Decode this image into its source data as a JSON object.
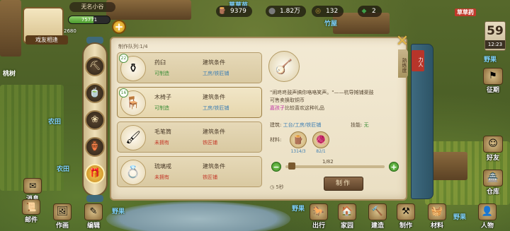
{
  "hud": {
    "title": "无名小谷",
    "exp_value": "75771",
    "exp_fraction": 0.6,
    "small_stat": "2680",
    "avatar_name": "戏友相逢",
    "plus": "+",
    "resources": [
      {
        "icon": "wood-icon",
        "glyph": "🪵",
        "value": "9379",
        "color": "#8a5a2a"
      },
      {
        "icon": "stone-icon",
        "glyph": "⬤",
        "value": "1.82万",
        "color": "#7a7a7a"
      },
      {
        "icon": "coin-icon",
        "glyph": "◎",
        "value": "132",
        "color": "#c9a33a"
      },
      {
        "icon": "jade-icon",
        "glyph": "◆",
        "value": "2",
        "color": "#3fa04a"
      }
    ],
    "calendar_day": "59",
    "calendar_time": "12:23"
  },
  "map_labels": [
    {
      "text": "草草苗",
      "cls": "blue"
    },
    {
      "text": "竹屋",
      "cls": "blue"
    },
    {
      "text": "草草药",
      "cls": "red"
    },
    {
      "text": "桃树",
      "cls": ""
    },
    {
      "text": "农田",
      "cls": "blue"
    },
    {
      "text": "农田",
      "cls": "blue"
    },
    {
      "text": "野果",
      "cls": "blue"
    },
    {
      "text": "野果",
      "cls": "blue"
    },
    {
      "text": "野果",
      "cls": "blue"
    },
    {
      "text": "野果",
      "cls": "blue"
    }
  ],
  "panel": {
    "queue_label": "制作队列:1/4",
    "close_glyph": "✕",
    "side_tab": "熟练度",
    "red_tab": "力人",
    "items": [
      {
        "badge": "22",
        "glyph": "⚱",
        "name": "药臼",
        "status": "可制造",
        "status_cls": "ok",
        "cond_label": "建筑条件",
        "cond_value": "工房/铁匠铺",
        "cond_cls": "",
        "selected": false,
        "icon": "mortar-icon"
      },
      {
        "badge": "16",
        "glyph": "🪑",
        "name": "木椅子",
        "status": "可制造",
        "status_cls": "ok",
        "cond_label": "建筑条件",
        "cond_value": "工房/铁匠铺",
        "cond_cls": "",
        "selected": true,
        "icon": "chair-icon"
      },
      {
        "badge": "",
        "glyph": "🖌",
        "name": "毛笔筒",
        "status": "未拥有",
        "status_cls": "no",
        "cond_label": "建筑条件",
        "cond_value": "铁匠铺",
        "cond_cls": "red",
        "selected": false,
        "icon": "brush-pot-icon"
      },
      {
        "badge": "",
        "glyph": "💍",
        "name": "琉璃戒",
        "status": "未拥有",
        "status_cls": "no",
        "cond_label": "建筑条件",
        "cond_value": "铁匠铺",
        "cond_cls": "red",
        "selected": false,
        "icon": "ring-icon"
      }
    ],
    "detail": {
      "glyph": "🪕",
      "quote_a": "\"闹咚咚鼓声搞你咯咯笑声。\"——杭导摊铺渠鼓",
      "quote_b": "可售卖换取铜币",
      "quote_hl": "嘉孩子",
      "quote_c": "比较喜欢这种礼品",
      "build_label": "建筑:",
      "build_value": "工台/工房/铁匠铺",
      "skill_label": "技能:",
      "skill_value": "无",
      "mat_label": "材料:",
      "materials": [
        {
          "glyph": "🪵",
          "count": "1314/3",
          "icon": "wood-material-icon"
        },
        {
          "glyph": "🧶",
          "count": "82/1",
          "icon": "cloth-material-icon"
        }
      ],
      "qty_text": "1/82",
      "minus": "−",
      "plus": "+",
      "timer": "5秒",
      "make_label": "制作"
    }
  },
  "categories": [
    {
      "glyph": "⛏",
      "icon": "pickaxe-icon",
      "active": false
    },
    {
      "glyph": "🍵",
      "icon": "pot-icon",
      "active": false
    },
    {
      "glyph": "❀",
      "icon": "flower-icon",
      "active": false
    },
    {
      "glyph": "🏺",
      "icon": "jar-icon",
      "active": false
    },
    {
      "glyph": "🎁",
      "icon": "gift-icon",
      "active": true
    }
  ],
  "left_buttons": [
    {
      "label": "消息",
      "glyph": "✉",
      "icon": "message-icon"
    },
    {
      "label": "邮件",
      "glyph": "📜",
      "icon": "mail-icon"
    }
  ],
  "bottom_buttons": [
    {
      "label": "作画",
      "glyph": "🖼",
      "icon": "paint-icon"
    },
    {
      "label": "编辑",
      "glyph": "✎",
      "icon": "edit-icon"
    },
    {
      "label": "出行",
      "glyph": "🐎",
      "icon": "travel-icon"
    },
    {
      "label": "家园",
      "glyph": "🏠",
      "icon": "home-icon"
    },
    {
      "label": "建造",
      "glyph": "🔨",
      "icon": "build-icon"
    },
    {
      "label": "制作",
      "glyph": "⚒",
      "icon": "craft-icon"
    },
    {
      "label": "材料",
      "glyph": "🧺",
      "icon": "material-icon"
    },
    {
      "label": "人物",
      "glyph": "👤",
      "icon": "character-icon"
    }
  ],
  "right_buttons": [
    {
      "label": "征期",
      "glyph": "⚑",
      "icon": "campaign-icon"
    },
    {
      "label": "好友",
      "glyph": "☺",
      "icon": "friend-icon"
    },
    {
      "label": "仓库",
      "glyph": "🏯",
      "icon": "warehouse-icon"
    }
  ]
}
